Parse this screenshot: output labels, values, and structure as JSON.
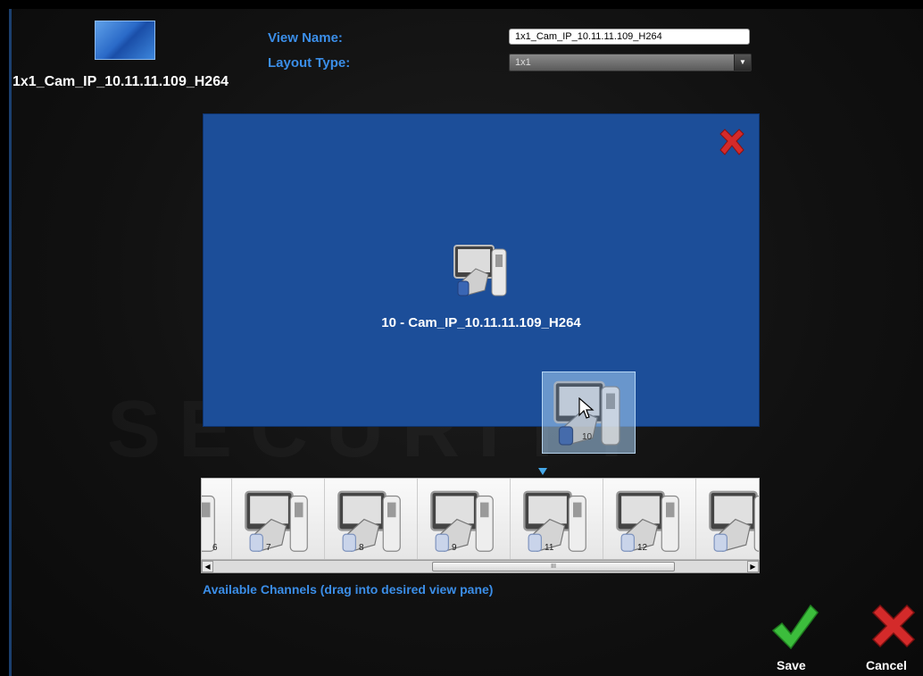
{
  "view": {
    "title": "1x1_Cam_IP_10.11.11.109_H264",
    "thumbnail_icon": "view-thumbnail-icon"
  },
  "form": {
    "view_name_label": "View Name:",
    "view_name_value": "1x1_Cam_IP_10.11.11.109_H264",
    "layout_type_label": "Layout Type:",
    "layout_type_value": "1x1"
  },
  "pane": {
    "channel_label": "10 - Cam_IP_10.11.11.109_H264",
    "background_color": "#1c4e99"
  },
  "drag": {
    "channel_number": "10"
  },
  "channels": [
    {
      "number": "6"
    },
    {
      "number": "7"
    },
    {
      "number": "8"
    },
    {
      "number": "9"
    },
    {
      "number": "11"
    },
    {
      "number": "12"
    },
    {
      "number": ""
    }
  ],
  "strip": {
    "hint": "Available Channels (drag into desired view pane)",
    "scroll_grip": "III"
  },
  "actions": {
    "save_label": "Save",
    "cancel_label": "Cancel"
  },
  "colors": {
    "accent_blue": "#3b8ee8",
    "save_green": "#3cbd3c",
    "cancel_red": "#d42a2a"
  }
}
